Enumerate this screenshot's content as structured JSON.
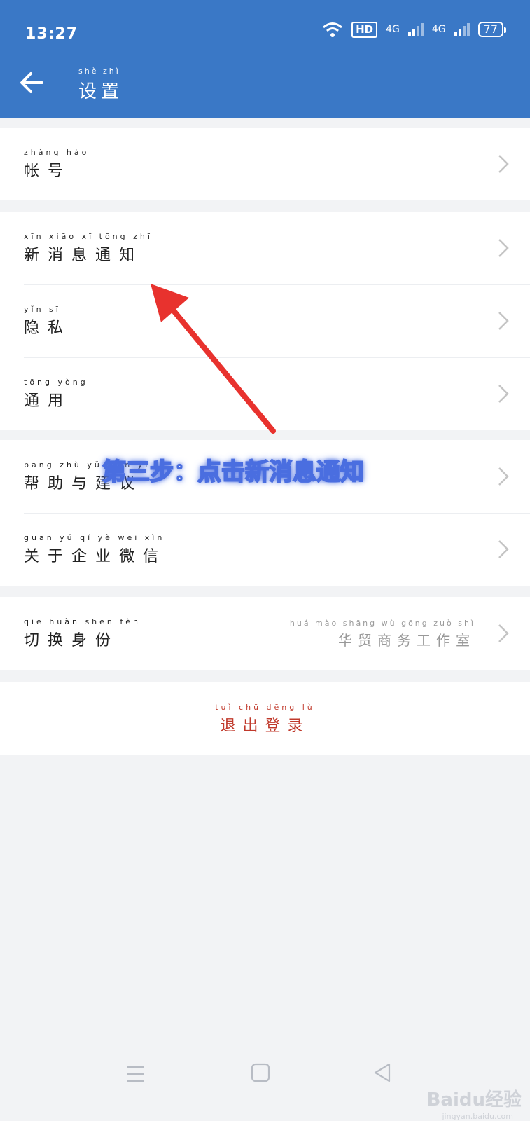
{
  "status_bar": {
    "time": "13:27",
    "hd": "HD",
    "net1": "4G",
    "net2": "4G",
    "battery": "77"
  },
  "header": {
    "title": "设置",
    "title_pinyin": "shè zhì"
  },
  "groups": [
    {
      "items": [
        {
          "label": "帐号",
          "pinyin": "zhàng hào"
        }
      ]
    },
    {
      "items": [
        {
          "label": "新消息通知",
          "pinyin": "xīn xiāo xī tōng zhī"
        },
        {
          "label": "隐私",
          "pinyin": "yǐn sī"
        },
        {
          "label": "通用",
          "pinyin": "tōng yòng"
        }
      ]
    },
    {
      "items": [
        {
          "label": "帮助与建议",
          "pinyin": "bāng zhù yǔ jiàn yì"
        },
        {
          "label": "关于企业微信",
          "pinyin": "guān yú qǐ yè wēi xìn"
        }
      ]
    },
    {
      "items": [
        {
          "label": "切换身份",
          "pinyin": "qiē huàn shēn fèn",
          "value": "华贸商务工作室",
          "value_pinyin": "huá mào shāng wù gōng zuò shì"
        }
      ]
    }
  ],
  "logout": {
    "label": "退出登录",
    "pinyin": "tuì chū dēng lù"
  },
  "annotation": {
    "text": "第三步：点击新消息通知"
  },
  "watermark": {
    "brand": "Baidu经验",
    "url": "jingyan.baidu.com"
  },
  "colors": {
    "primary": "#3a78c6",
    "logout": "#c0392b",
    "annotation_glow": "#4a6ee0",
    "arrow": "#e8322e"
  }
}
